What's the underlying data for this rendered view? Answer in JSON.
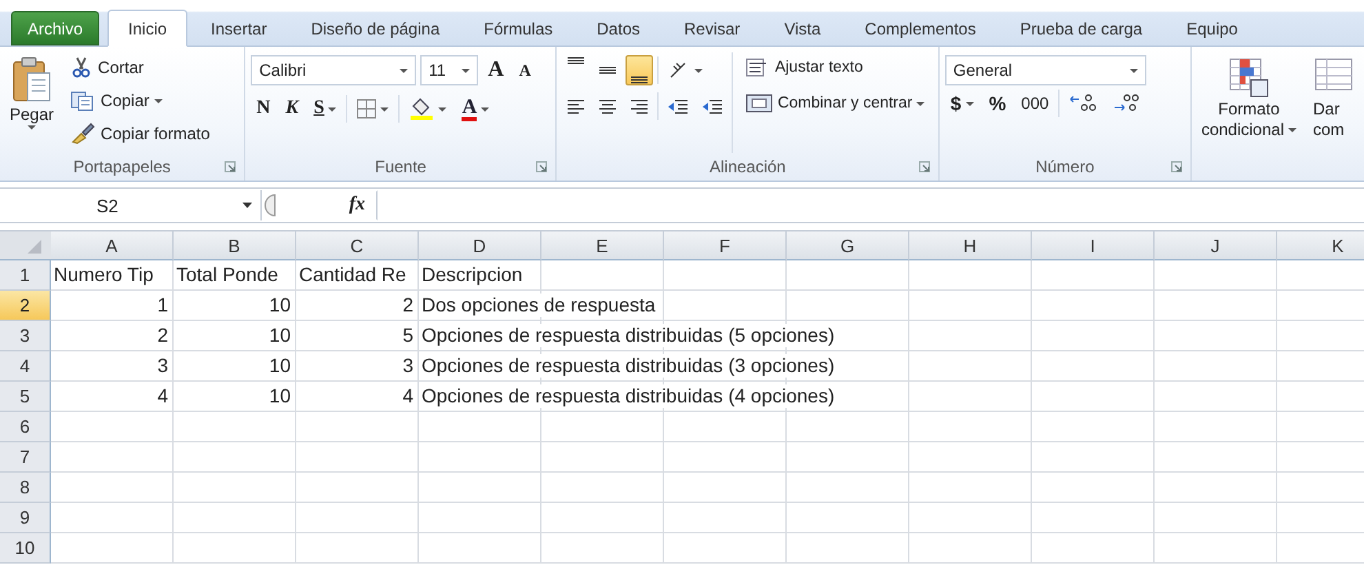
{
  "ribbon_tabs": [
    {
      "label": "Archivo",
      "kind": "file",
      "selected": false
    },
    {
      "label": "Inicio",
      "kind": "tab",
      "selected": true
    },
    {
      "label": "Insertar",
      "kind": "tab",
      "selected": false
    },
    {
      "label": "Diseño de página",
      "kind": "tab",
      "selected": false
    },
    {
      "label": "Fórmulas",
      "kind": "tab",
      "selected": false
    },
    {
      "label": "Datos",
      "kind": "tab",
      "selected": false
    },
    {
      "label": "Revisar",
      "kind": "tab",
      "selected": false
    },
    {
      "label": "Vista",
      "kind": "tab",
      "selected": false
    },
    {
      "label": "Complementos",
      "kind": "tab",
      "selected": false
    },
    {
      "label": "Prueba de carga",
      "kind": "tab",
      "selected": false
    },
    {
      "label": "Equipo",
      "kind": "tab",
      "selected": false
    }
  ],
  "clipboard_group": {
    "paste": "Pegar",
    "cut": "Cortar",
    "copy": "Copiar",
    "format_painter": "Copiar formato",
    "label": "Portapapeles"
  },
  "font_group": {
    "font": "Calibri",
    "size": "11",
    "grow_font": "A",
    "shrink_font": "A",
    "bold": "N",
    "italic": "K",
    "underline": "S",
    "font_color": "A",
    "label": "Fuente"
  },
  "alignment_group": {
    "vertical_align": [
      {
        "on": false
      },
      {
        "on": false
      },
      {
        "on": true
      }
    ],
    "wrap_text": "Ajustar texto",
    "merge_center": "Combinar y centrar",
    "label": "Alineación"
  },
  "number_group": {
    "format": "General",
    "currency": "$",
    "percent": "%",
    "thousands": "000",
    "label": "Número"
  },
  "styles_group": {
    "conditional_format": [
      "Formato",
      "condicional"
    ],
    "next_button": [
      "Dar",
      "com"
    ]
  },
  "name_box": "S2",
  "function_label": "fx",
  "columns": [
    {
      "label": "A",
      "selected": false
    },
    {
      "label": "B",
      "selected": false
    },
    {
      "label": "C",
      "selected": false
    },
    {
      "label": "D",
      "selected": false
    },
    {
      "label": "E",
      "selected": false
    },
    {
      "label": "F",
      "selected": false
    },
    {
      "label": "G",
      "selected": false
    },
    {
      "label": "H",
      "selected": false
    },
    {
      "label": "I",
      "selected": false
    },
    {
      "label": "J",
      "selected": false
    },
    {
      "label": "K",
      "selected": false
    }
  ],
  "rows": [
    {
      "number": "1",
      "selected": false,
      "cells": [
        {
          "text": "Numero Tip",
          "kind": "text"
        },
        {
          "text": "Total Ponde",
          "kind": "text"
        },
        {
          "text": "Cantidad Re",
          "kind": "text"
        },
        {
          "text": "Descripcion",
          "kind": "text"
        }
      ]
    },
    {
      "number": "2",
      "selected": true,
      "cells": [
        {
          "text": "1",
          "kind": "number"
        },
        {
          "text": "10",
          "kind": "number"
        },
        {
          "text": "2",
          "kind": "number"
        },
        {
          "text": "Dos opciones de respuesta",
          "kind": "text"
        }
      ]
    },
    {
      "number": "3",
      "selected": false,
      "cells": [
        {
          "text": "2",
          "kind": "number"
        },
        {
          "text": "10",
          "kind": "number"
        },
        {
          "text": "5",
          "kind": "number"
        },
        {
          "text": "Opciones de respuesta distribuidas (5 opciones)",
          "kind": "text"
        }
      ]
    },
    {
      "number": "4",
      "selected": false,
      "cells": [
        {
          "text": "3",
          "kind": "number"
        },
        {
          "text": "10",
          "kind": "number"
        },
        {
          "text": "3",
          "kind": "number"
        },
        {
          "text": "Opciones de respuesta distribuidas (3 opciones)",
          "kind": "text"
        }
      ]
    },
    {
      "number": "5",
      "selected": false,
      "cells": [
        {
          "text": "4",
          "kind": "number"
        },
        {
          "text": "10",
          "kind": "number"
        },
        {
          "text": "4",
          "kind": "number"
        },
        {
          "text": "Opciones de respuesta distribuidas (4 opciones)",
          "kind": "text"
        }
      ]
    },
    {
      "number": "6",
      "selected": false,
      "cells": []
    },
    {
      "number": "7",
      "selected": false,
      "cells": []
    },
    {
      "number": "8",
      "selected": false,
      "cells": []
    },
    {
      "number": "9",
      "selected": false,
      "cells": []
    },
    {
      "number": "10",
      "selected": false,
      "cells": []
    }
  ]
}
